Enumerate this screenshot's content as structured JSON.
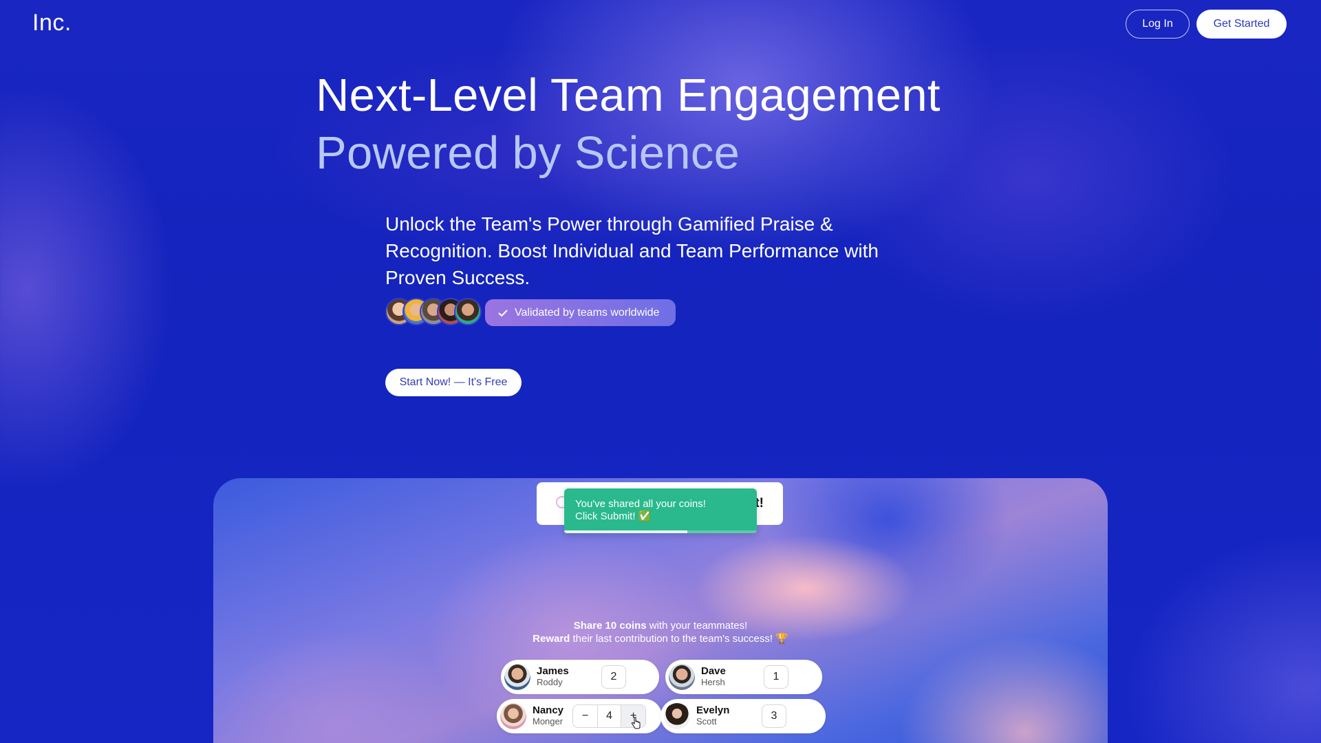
{
  "header": {
    "logo": "Inc.",
    "login_label": "Log In",
    "get_started_label": "Get Started"
  },
  "hero": {
    "title_line1": "Next-Level Team Engagement",
    "title_line2": "Powered by Science",
    "subtitle": "Unlock the Team's Power through Gamified Praise & Recognition. Boost Individual and Team Performance with Proven Success.",
    "validated_label": "Validated by teams worldwide",
    "cta_label": "Start Now! — It's Free"
  },
  "demo": {
    "card_title_tail": "t!",
    "toast": {
      "line1": "You've shared all your coins!",
      "line2": "Click Submit! ✅",
      "progress": 0.64
    },
    "instructions": {
      "line1_bold": "Share 10 coins",
      "line1_rest": " with your teammates!",
      "line2_bold": "Reward",
      "line2_rest": " their last contribution to the team's success! 🏆"
    },
    "teammates": [
      {
        "first": "James",
        "last": "Roddy",
        "coins": "2"
      },
      {
        "first": "Dave",
        "last": "Hersh",
        "coins": "1"
      },
      {
        "first": "Nancy",
        "last": "Monger",
        "coins": "4",
        "minus": "−",
        "plus": "+"
      },
      {
        "first": "Evelyn",
        "last": "Scott",
        "coins": "3"
      }
    ]
  },
  "colors": {
    "background": "#1a26c2",
    "headline_secondary": "#b7c7f7",
    "toast": "#29b98c",
    "cta_text": "#2f3db5"
  }
}
